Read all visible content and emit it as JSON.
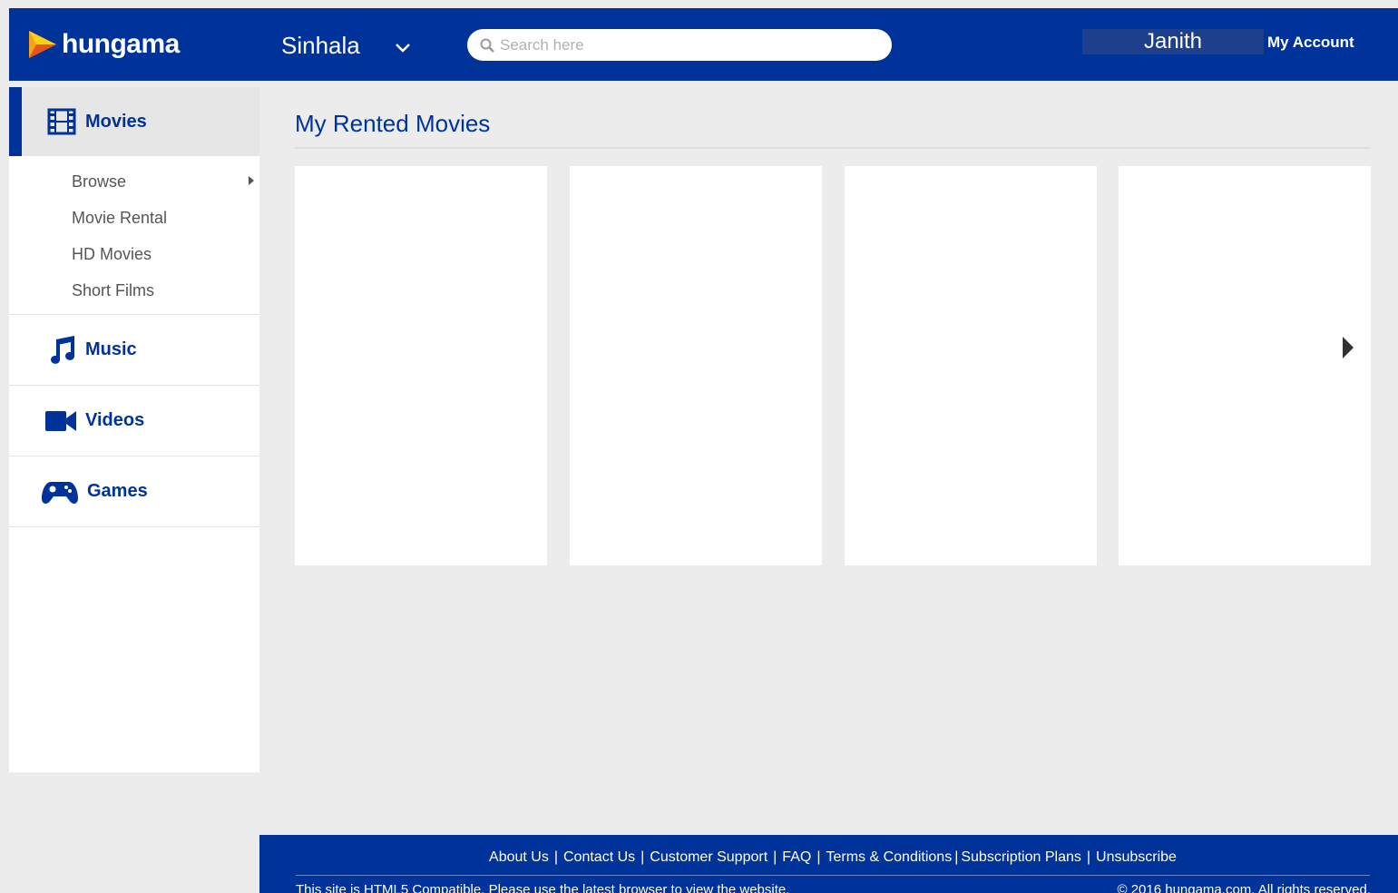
{
  "brand": {
    "name": "hungama",
    "accent": "#003399"
  },
  "header": {
    "language": "Sinhala",
    "search_placeholder": "Search here",
    "user_name": "Janith",
    "account_label": "My Account"
  },
  "sidebar": {
    "movies": {
      "label": "Movies",
      "icon": "film-icon",
      "submenu": [
        "Browse",
        "Movie Rental",
        "HD Movies",
        "Short Films"
      ]
    },
    "items": [
      {
        "label": "Music",
        "icon": "music-note-icon"
      },
      {
        "label": "Videos",
        "icon": "video-camera-icon"
      },
      {
        "label": "Games",
        "icon": "gamepad-icon"
      }
    ]
  },
  "main": {
    "title": "My Rented Movies",
    "card_count": 4
  },
  "footer": {
    "links": [
      "About Us",
      "Contact Us",
      "Customer Support",
      "FAQ",
      "Terms & Conditions",
      "Subscription Plans",
      "Unsubscribe"
    ],
    "note": "This site is HTML5 Compatible. Please use the latest browser to view the website.",
    "copyright": "© 2016 hungama.com. All rights reserved."
  }
}
